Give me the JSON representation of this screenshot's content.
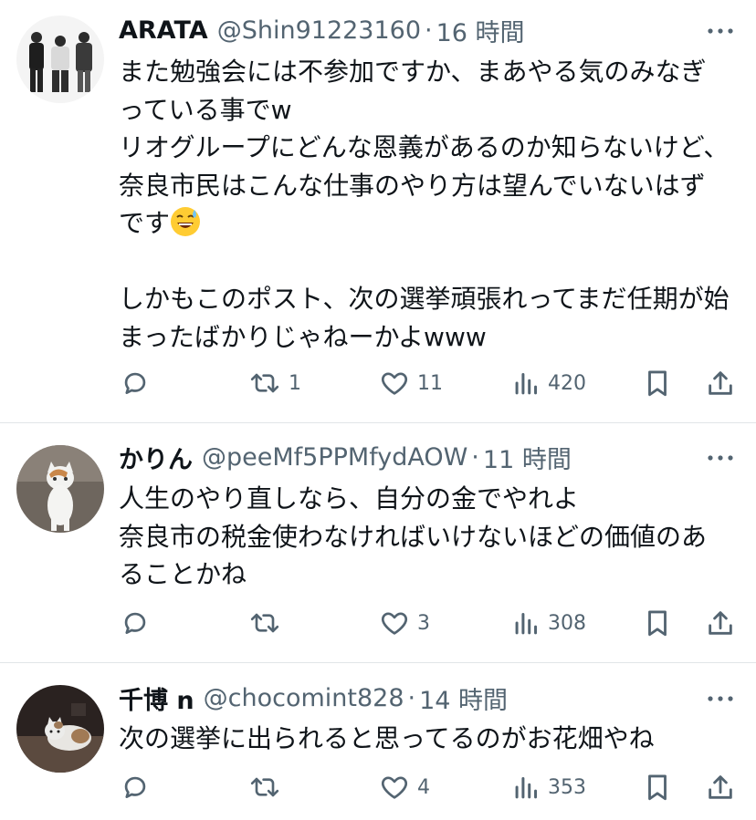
{
  "tweets": [
    {
      "name": "ARATA",
      "handle": "@Shin91223160",
      "dot": "·",
      "time": "16 時間",
      "text_before_emoji": "また勉強会には不参加ですか、まあやる気のみなぎっている事でw\nリオグループにどんな恩義があるのか知らないけど、奈良市民はこんな仕事のやり方は望んでいないはずです",
      "emoji": "grinning-sweat-emoji",
      "text_after_emoji": "\n\nしかもこのポスト、次の選挙頑張れってまだ任期が始まったばかりじゃねーかよwww",
      "retweets": "1",
      "likes": "11",
      "views": "420"
    },
    {
      "name": "かりん",
      "handle": "@peeMf5PPMfydAOW",
      "dot": "·",
      "time": "11 時間",
      "text": "人生のやり直しなら、自分の金でやれよ\n奈良市の税金使わなければいけないほどの価値のあることかね",
      "retweets": "",
      "likes": "3",
      "views": "308"
    },
    {
      "name": "千博 n",
      "handle": "@chocomint828",
      "dot": "·",
      "time": "14 時間",
      "text": "次の選挙に出られると思ってるのがお花畑やね",
      "retweets": "",
      "likes": "4",
      "views": "353"
    }
  ],
  "icons": {
    "more": "more-icon",
    "reply": "reply-icon",
    "retweet": "retweet-icon",
    "like": "heart-icon",
    "views": "views-icon",
    "bookmark": "bookmark-icon",
    "share": "share-icon"
  },
  "colors": {
    "text": "#0f1419",
    "secondary": "#536471",
    "divider": "#e1e5e8"
  }
}
